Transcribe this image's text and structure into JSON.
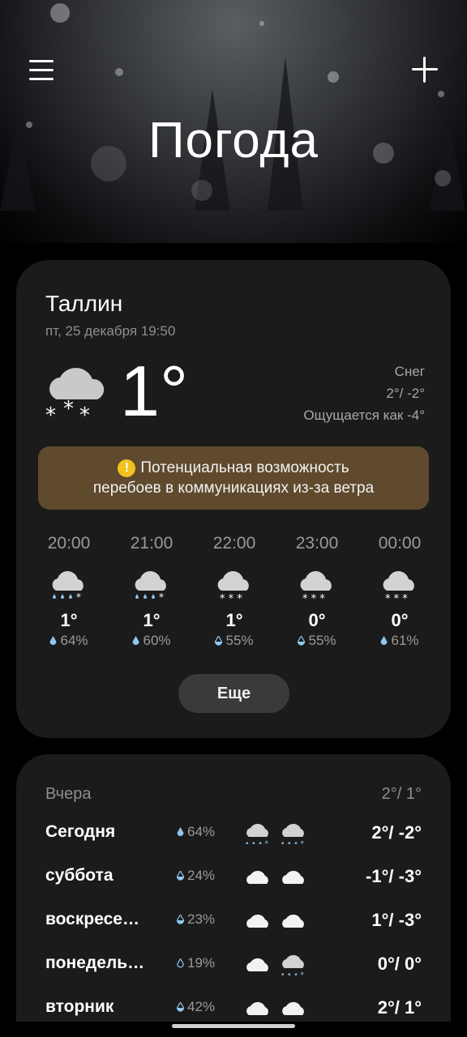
{
  "header": {
    "title": "Погода",
    "menu_icon": "hamburger-menu-icon",
    "add_icon": "plus-icon"
  },
  "current": {
    "city": "Таллин",
    "datetime": "пт, 25 декабря 19:50",
    "temp": "1°",
    "condition": "Снег",
    "high_low": "2°/ -2°",
    "feels_like": "Ощущается как -4°",
    "icon": "cloud-snow-icon"
  },
  "alert": {
    "line1": "Потенциальная возможность",
    "line2": "перебоев в коммуникациях из-за ветра",
    "icon": "warning-icon",
    "color": "#5f4a2d"
  },
  "hourly": [
    {
      "time": "20:00",
      "temp": "1°",
      "pop": "64%",
      "icon": "cloud-snow-rain-icon"
    },
    {
      "time": "21:00",
      "temp": "1°",
      "pop": "60%",
      "icon": "cloud-snow-rain-icon"
    },
    {
      "time": "22:00",
      "temp": "1°",
      "pop": "55%",
      "icon": "cloud-snow-icon"
    },
    {
      "time": "23:00",
      "temp": "0°",
      "pop": "55%",
      "icon": "cloud-snow-icon"
    },
    {
      "time": "00:00",
      "temp": "0°",
      "pop": "61%",
      "icon": "cloud-snow-icon"
    }
  ],
  "more_label": "Еще",
  "daily": {
    "yesterday_label": "Вчера",
    "yesterday_temp": "2°/ 1°",
    "days": [
      {
        "name": "Сегодня",
        "pop": "64%",
        "icon1": "cloud-snow-rain-icon",
        "icon2": "cloud-snow-rain-icon",
        "temp": "2°/ -2°"
      },
      {
        "name": "суббота",
        "pop": "24%",
        "icon1": "cloud-icon",
        "icon2": "cloud-icon",
        "temp": "-1°/ -3°"
      },
      {
        "name": "воскресе…",
        "pop": "23%",
        "icon1": "cloud-icon",
        "icon2": "cloud-icon",
        "temp": "1°/ -3°"
      },
      {
        "name": "понедель…",
        "pop": "19%",
        "icon1": "cloud-icon",
        "icon2": "cloud-snow-rain-icon",
        "temp": "0°/ 0°"
      },
      {
        "name": "вторник",
        "pop": "42%",
        "icon1": "cloud-icon",
        "icon2": "cloud-icon",
        "temp": "2°/ 1°"
      }
    ]
  }
}
